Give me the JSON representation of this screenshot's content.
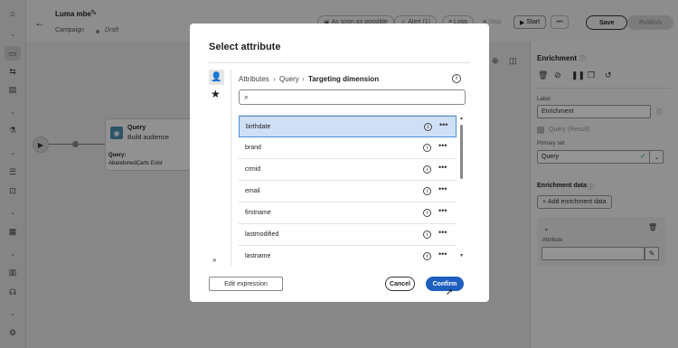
{
  "header": {
    "campaign_name": "Luma mbe",
    "campaign_type": "Campaign",
    "status": "Draft",
    "buttons": {
      "schedule": "As soon as possible",
      "alert": "Alert (1)",
      "logs": "Logs",
      "stop": "Stop",
      "start": "Start",
      "save": "Save",
      "publish": "Publish"
    }
  },
  "canvas": {
    "query_node": {
      "title": "Query",
      "subtitle": "Build audience",
      "label": "Query:",
      "value": "AbandonedCarts Exist"
    }
  },
  "right_panel": {
    "title": "Enrichment",
    "label_field": {
      "label": "Label",
      "value": "Enrichment"
    },
    "checkbox_label": "Query (Result)",
    "primary_set": {
      "label": "Primary set",
      "value": "Query"
    },
    "enrichment_data": {
      "title": "Enrichment data",
      "add_button": "Add enrichment data",
      "attribute_label": "Attribute"
    }
  },
  "modal": {
    "title": "Select attribute",
    "breadcrumb": [
      "Attributes",
      "Query",
      "Targeting dimension"
    ],
    "search_placeholder": "",
    "items": [
      "birthdate",
      "brand",
      "crmid",
      "email",
      "firstname",
      "lastmodified",
      "lastname"
    ],
    "selected_item": "birthdate",
    "buttons": {
      "edit_expression": "Edit expression",
      "cancel": "Cancel",
      "confirm": "Confirm"
    }
  },
  "colors": {
    "accent": "#1e5fbf",
    "selected_row": "#cfe0f6",
    "selected_border": "#4a8fd9",
    "success": "#2d9d78"
  }
}
